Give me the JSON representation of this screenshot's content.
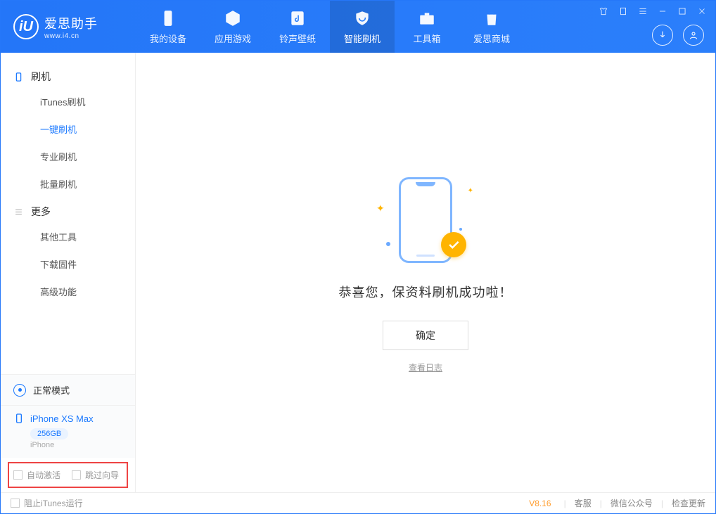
{
  "app": {
    "title": "爱思助手",
    "subtitle": "www.i4.cn"
  },
  "nav": {
    "device": "我的设备",
    "apps": "应用游戏",
    "ringtones": "铃声壁纸",
    "flash": "智能刷机",
    "toolbox": "工具箱",
    "store": "爱思商城"
  },
  "sidebar": {
    "group_flash": "刷机",
    "items_flash": {
      "itunes": "iTunes刷机",
      "oneclick": "一键刷机",
      "pro": "专业刷机",
      "batch": "批量刷机"
    },
    "group_more": "更多",
    "items_more": {
      "other": "其他工具",
      "firmware": "下载固件",
      "advanced": "高级功能"
    }
  },
  "device": {
    "mode": "正常模式",
    "name": "iPhone XS Max",
    "storage": "256GB",
    "type": "iPhone"
  },
  "options": {
    "auto_activate": "自动激活",
    "skip_guide": "跳过向导"
  },
  "main": {
    "success": "恭喜您，保资料刷机成功啦！",
    "ok": "确定",
    "view_log": "查看日志"
  },
  "footer": {
    "block_itunes": "阻止iTunes运行",
    "version": "V8.16",
    "support": "客服",
    "wechat": "微信公众号",
    "update": "检查更新"
  }
}
